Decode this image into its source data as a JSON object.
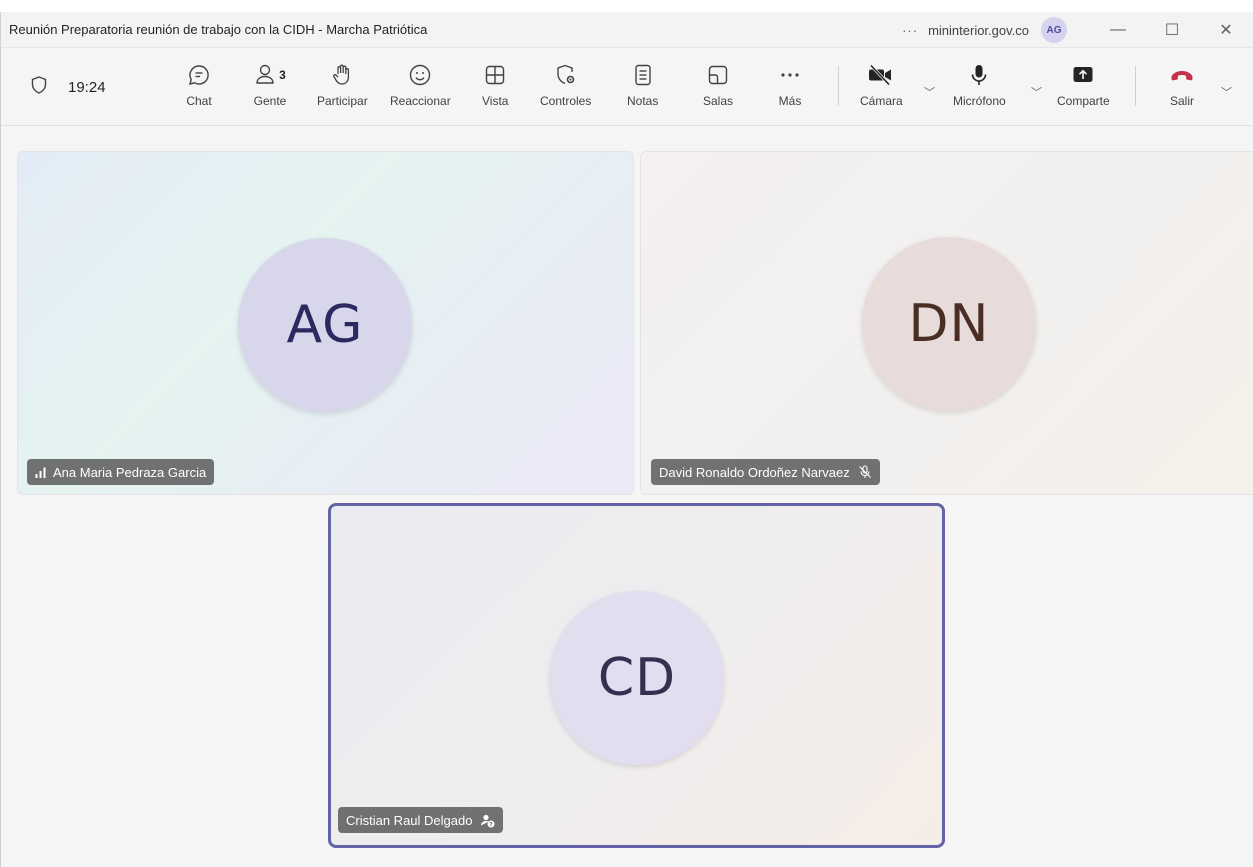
{
  "window": {
    "title": "Reunión Preparatoria reunión de trabajo con la CIDH - Marcha Patriótica",
    "more": "···",
    "domain": "mininterior.gov.co",
    "user_initials": "AG",
    "minimize": "—",
    "maximize": "☐",
    "close": "✕"
  },
  "toolbar": {
    "timer": "19:24",
    "buttons": {
      "chat": "Chat",
      "people": "Gente",
      "people_count": "3",
      "raise": "Participar",
      "react": "Reaccionar",
      "view": "Vista",
      "controls": "Controles",
      "notes": "Notas",
      "rooms": "Salas",
      "more": "Más",
      "camera": "Cámara",
      "mic": "Micrófono",
      "share": "Comparte",
      "leave": "Salir"
    }
  },
  "participants": [
    {
      "initials": "AG",
      "name": "Ana Maria Pedraza Garcia",
      "status_icon": "signal-bars-icon"
    },
    {
      "initials": "DN",
      "name": "David Ronaldo Ordoñez Narvaez",
      "status_icon": "mic-off-icon"
    },
    {
      "initials": "CD",
      "name": "Cristian Raul Delgado",
      "status_icon": "guest-icon"
    }
  ],
  "colors": {
    "accent": "#6264a7",
    "leave_red": "#c4314b"
  }
}
